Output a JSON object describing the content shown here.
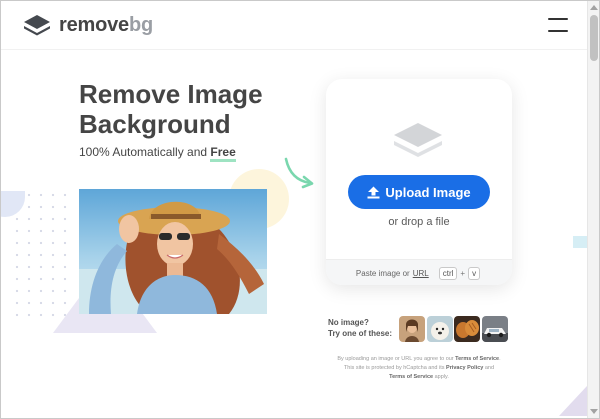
{
  "header": {
    "logo_remove": "remove",
    "logo_bg": "bg",
    "menu_icon": "hamburger-menu-icon"
  },
  "hero": {
    "headline_line1": "Remove Image",
    "headline_line2": "Background",
    "subline_prefix": "100% Automatically and ",
    "subline_free": "Free"
  },
  "upload": {
    "button_label": "Upload Image",
    "drop_text": "or drop a file",
    "paste_text": "Paste image or",
    "url_label": "URL",
    "key_ctrl": "ctrl",
    "key_plus": "+",
    "key_v": "v",
    "icon": "layers-stack-icon"
  },
  "samples": {
    "line1": "No image?",
    "line2": "Try one of these:",
    "items": [
      "woman-sample",
      "dog-sample",
      "bread-sample",
      "car-sample"
    ]
  },
  "legal": {
    "line1_prefix": "By uploading an image or URL you agree to our ",
    "terms_link": "Terms of Service",
    "line1_suffix": ".",
    "line2_prefix": "This site is protected by hCaptcha and its ",
    "privacy_link": "Privacy Policy",
    "line2_suffix": " and",
    "terms_link2": "Terms of Service",
    "line3_suffix": " apply."
  },
  "colors": {
    "accent": "#1a6ee6",
    "text": "#454545",
    "highlight": "#9ee3c2"
  }
}
